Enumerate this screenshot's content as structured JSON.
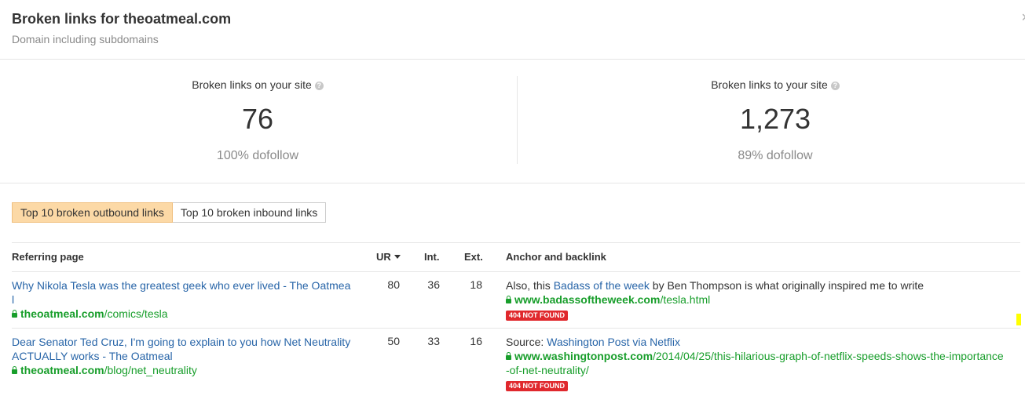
{
  "header": {
    "title": "Broken links for theoatmeal.com",
    "subtitle": "Domain including subdomains",
    "close_label": "×"
  },
  "stats": {
    "left": {
      "label": "Broken links on your site",
      "value": "76",
      "sub": "100% dofollow"
    },
    "right": {
      "label": "Broken links to your site",
      "value": "1,273",
      "sub": "89% dofollow"
    }
  },
  "tabs": [
    {
      "label": "Top 10 broken outbound links",
      "active": true
    },
    {
      "label": "Top 10 broken inbound links",
      "active": false
    }
  ],
  "table": {
    "headers": {
      "referring_page": "Referring page",
      "ur": "UR",
      "int": "Int.",
      "ext": "Ext.",
      "anchor": "Anchor and backlink"
    },
    "rows": [
      {
        "title_line1": "Why Nikola Tesla was the greatest geek who ever lived - The Oatmea",
        "title_line2": "l",
        "domain": "theoatmeal.com",
        "path": "/comics/tesla",
        "ur": "80",
        "int": "36",
        "ext": "18",
        "anchor_pre": "Also, this ",
        "anchor_link": "Badass of the week",
        "anchor_post": " by Ben Thompson is what originally inspired me to write",
        "backlink_domain": "www.badassoftheweek.com",
        "backlink_path": "/tesla.html",
        "backlink_path2": "",
        "status": "404 NOT FOUND"
      },
      {
        "title_line1": "Dear Senator Ted Cruz, I'm going to explain to you how Net Neutrality",
        "title_line2": "ACTUALLY works - The Oatmeal",
        "domain": "theoatmeal.com",
        "path": "/blog/net_neutrality",
        "ur": "50",
        "int": "33",
        "ext": "16",
        "anchor_pre": "Source: ",
        "anchor_link": "Washington Post via Netflix",
        "anchor_post": "",
        "backlink_domain": "www.washingtonpost.com",
        "backlink_path": "/2014/04/25/this-hilarious-graph-of-netflix-speeds-shows-the-importance",
        "backlink_path2": "-of-net-neutrality/",
        "status": "404 NOT FOUND"
      }
    ]
  },
  "colors": {
    "link": "#2865a8",
    "green": "#189e2b",
    "active_tab": "#fcd9a6",
    "badge": "#e0282d"
  }
}
